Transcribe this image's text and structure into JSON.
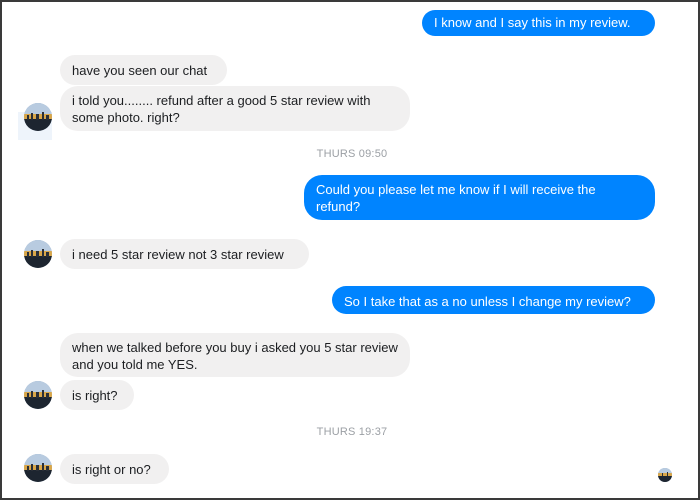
{
  "colors": {
    "outgoing_bubble": "#0084ff",
    "incoming_bubble": "#f1f0f0",
    "timestamp_text": "#9b9fa4"
  },
  "avatar": {
    "icon": "contact-avatar-icon"
  },
  "read_receipt": {
    "icon": "seen-avatar-icon"
  },
  "messages": [
    {
      "direction": "outgoing",
      "text": "I know and I say this in my review."
    },
    {
      "direction": "incoming",
      "text": "have you seen our chat"
    },
    {
      "direction": "incoming",
      "text": "i told you........ refund after a good 5 star review with some photo. right?"
    },
    {
      "direction": "timestamp",
      "text": "THURS 09:50"
    },
    {
      "direction": "outgoing",
      "text": "Could you please let me know if I will receive the refund?"
    },
    {
      "direction": "incoming",
      "text": "i need 5 star review not 3 star review"
    },
    {
      "direction": "outgoing",
      "text": "So I take that as a no unless I change my review?"
    },
    {
      "direction": "incoming",
      "text": "when we talked before you buy i asked you 5 star review and you told me YES."
    },
    {
      "direction": "incoming",
      "text": "is right?"
    },
    {
      "direction": "timestamp",
      "text": "THURS 19:37"
    },
    {
      "direction": "incoming",
      "text": "is right or no?"
    }
  ]
}
